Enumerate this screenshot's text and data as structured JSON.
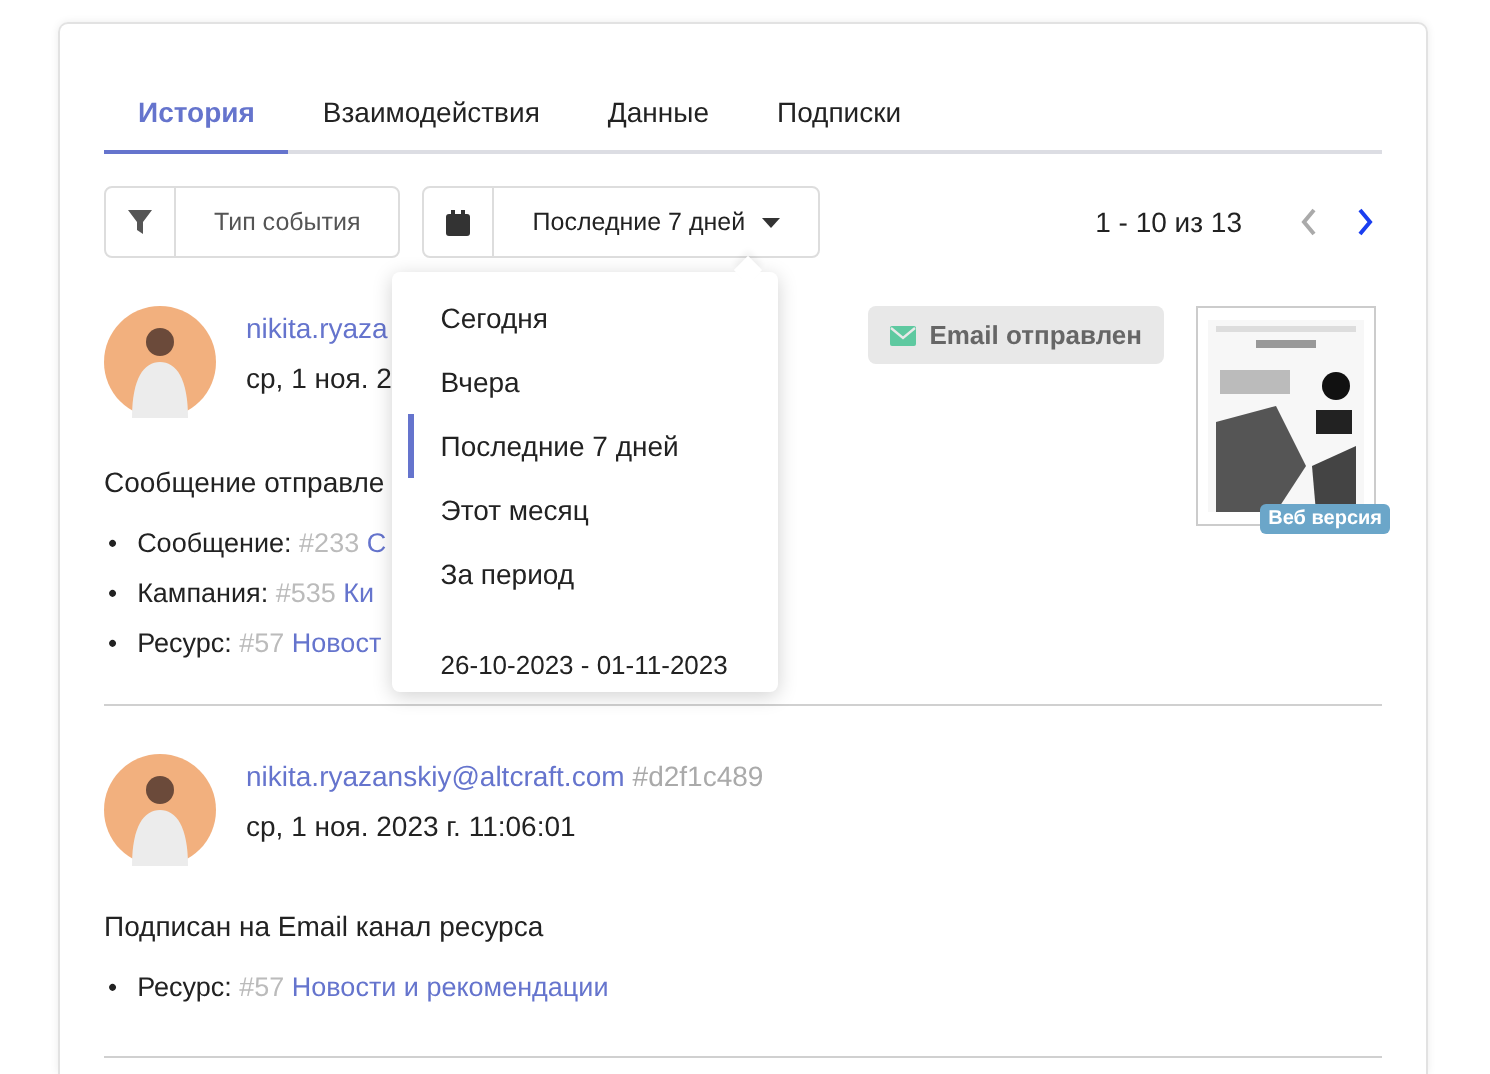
{
  "tabs": [
    {
      "label": "История",
      "selected": true
    },
    {
      "label": "Взаимодействия",
      "selected": false
    },
    {
      "label": "Данные",
      "selected": false
    },
    {
      "label": "Подписки",
      "selected": false
    }
  ],
  "filters": {
    "event_type": {
      "label": "Тип события"
    },
    "period": {
      "value": "Последние 7 дней",
      "open": true
    }
  },
  "pagination": {
    "range": "1 - 10 из 13",
    "prev_disabled": true,
    "next_disabled": false
  },
  "period_menu": {
    "items": [
      {
        "label": "Сегодня",
        "selected": false
      },
      {
        "label": "Вчера",
        "selected": false
      },
      {
        "label": "Последние 7 дней",
        "selected": true
      },
      {
        "label": "Этот месяц",
        "selected": false
      },
      {
        "label": "За период",
        "selected": false
      }
    ],
    "date_range": "26-10-2023 - 01-11-2023"
  },
  "bullet": "•",
  "events": [
    {
      "email": "nikita.ryaza",
      "date": "ср, 1 ноя. 2",
      "status": "Email отправлен",
      "preview": {
        "kind": "picture",
        "badge": "Веб версия"
      },
      "description": "Сообщение отправле",
      "details": [
        {
          "label": "Сообщение:",
          "id": "#233",
          "name": "С"
        },
        {
          "label": "Кампания:",
          "id": "#535",
          "name": "Ки"
        },
        {
          "label": "Ресурс:",
          "id": "#57",
          "name": "Новост"
        }
      ]
    },
    {
      "email": "nikita.ryazanskiy@altcraft.com",
      "hash": "#d2f1c489",
      "date": "ср, 1 ноя. 2023 г. 11:06:01",
      "description": "Подписан на Email канал ресурса",
      "details": [
        {
          "label": "Ресурс:",
          "id": "#57",
          "name": "Новости и рекомендации"
        }
      ]
    }
  ]
}
